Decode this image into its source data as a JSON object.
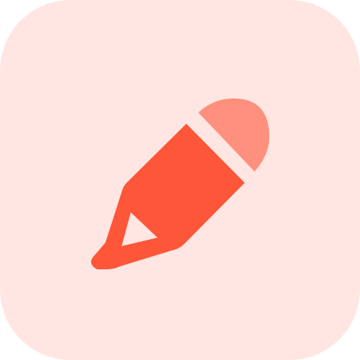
{
  "icon": {
    "name": "pencil-icon",
    "colors": {
      "background": "#ffe6e2",
      "pencil_body": "#fe5638",
      "pencil_eraser": "#ff907d"
    }
  }
}
